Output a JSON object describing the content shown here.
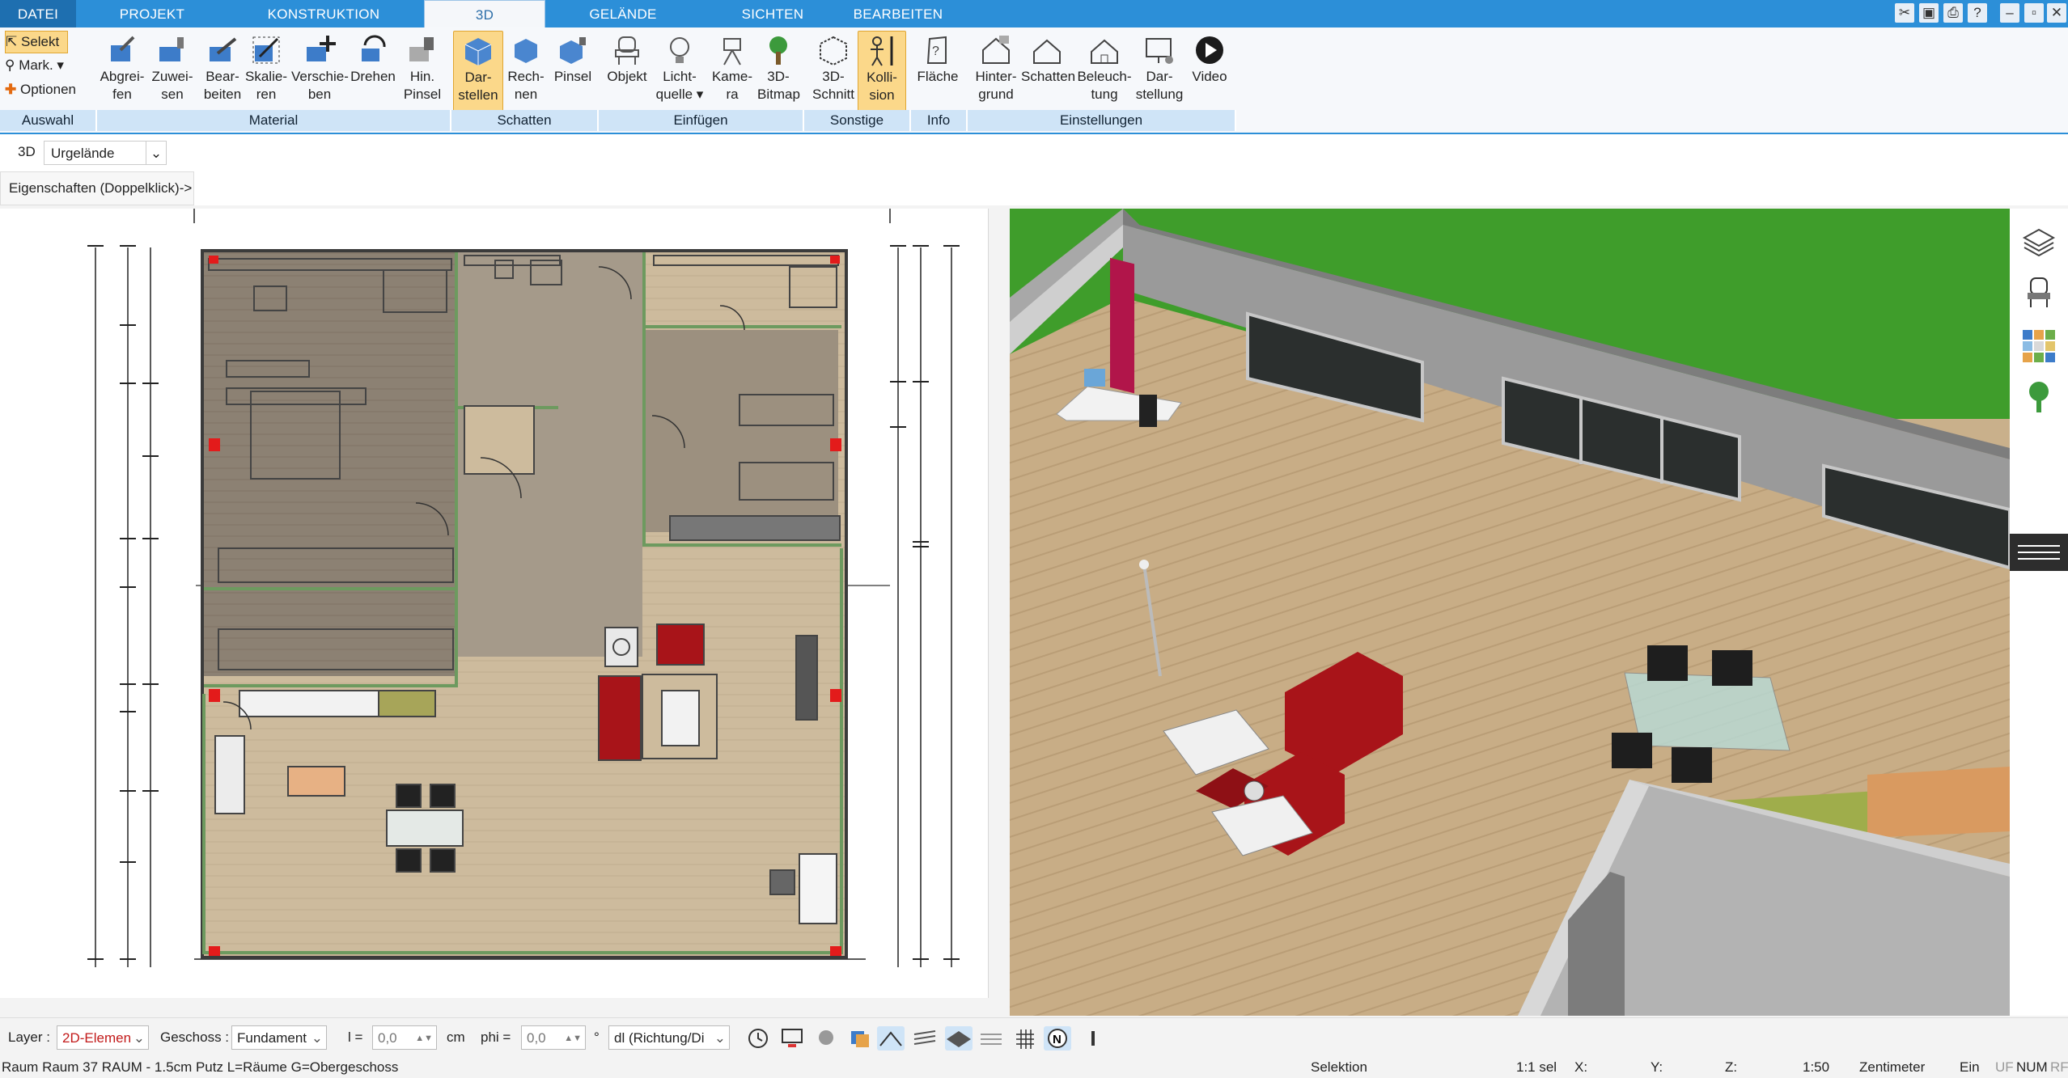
{
  "tabs": [
    "DATEI",
    "PROJEKT",
    "KONSTRUKTION",
    "3D",
    "GELÄNDE",
    "SICHTEN",
    "BEARBEITEN"
  ],
  "selection_tools": {
    "select": "Selekt",
    "mark": "Mark.",
    "options": "Optionen"
  },
  "ribbon_buttons": {
    "abgreifen": "Abgrei-\nfen",
    "zuweisen": "Zuwei-\nsen",
    "bearbeiten": "Bear-\nbeiten",
    "skalieren": "Skalie-\nren",
    "verschieben": "Verschie-\nben",
    "drehen": "Drehen",
    "hin_pinsel": "Hin.\nPinsel",
    "darstellen": "Dar-\nstellen",
    "rechnen": "Rech-\nnen",
    "pinsel": "Pinsel",
    "objekt": "Objekt",
    "lichtquelle": "Licht-\nquelle ▾",
    "kamera": "Kame-\nra",
    "bitmap": "3D-\nBitmap",
    "schnitt": "3D-\nSchnitt",
    "kollision": "Kolli-\nsion",
    "flaeche": "Fläche",
    "hintergrund": "Hinter-\ngrund",
    "schatten": "Schatten",
    "beleuchtung": "Beleuch-\ntung",
    "darstellung": "Dar-\nstellung",
    "video": "Video"
  },
  "groups": [
    "Auswahl",
    "Material",
    "Schatten",
    "Einfügen",
    "Sonstige",
    "Info",
    "Einstellungen"
  ],
  "view_mode": {
    "label": "3D",
    "value": "Urgelände"
  },
  "properties_hint": "Eigenschaften (Doppelklick)->",
  "bottom": {
    "layer_label": "Layer :",
    "layer_value": "2D-Elemen",
    "geschoss_label": "Geschoss :",
    "geschoss_value": "Fundament",
    "l_label": "l =",
    "l_value": "0,0",
    "l_unit": "cm",
    "phi_label": "phi =",
    "phi_value": "0,0",
    "phi_unit": "°",
    "dl_value": "dl (Richtung/Di"
  },
  "status": {
    "left": "Raum Raum 37 RAUM - 1.5cm Putz L=Räume G=Obergeschoss",
    "mode": "Selektion",
    "sel": "1:1 sel",
    "x": "X:",
    "y": "Y:",
    "z": "Z:",
    "scale": "1:50",
    "unit": "Zentimeter",
    "ein": "Ein",
    "uf": "UF",
    "num": "NUM",
    "rf": "RF"
  },
  "colors": {
    "accent": "#2c8fd8",
    "wall": "#6d9a5f",
    "floor": "#cbb798",
    "grass": "#3f9d2b",
    "sofa": "#a81419"
  }
}
